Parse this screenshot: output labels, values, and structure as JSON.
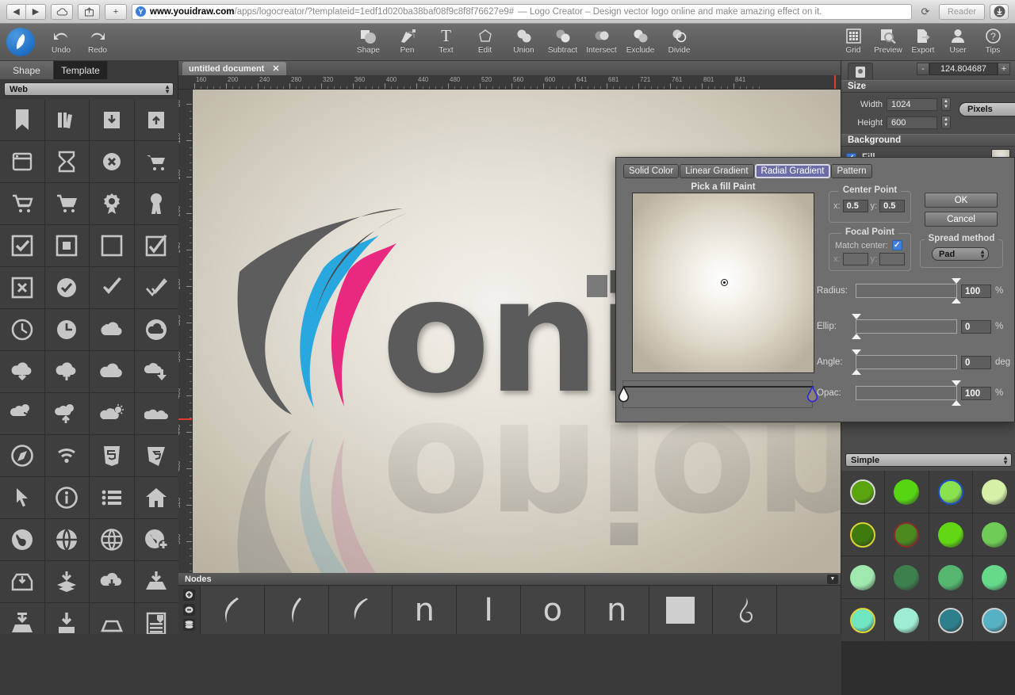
{
  "browser": {
    "back_icon": "back-arrow-icon",
    "forward_icon": "forward-arrow-icon",
    "icloud_icon": "icloud-icon",
    "share_icon": "share-icon",
    "add_tab_label": "+",
    "favicon_letter": "Y",
    "url_domain": "www.youidraw.com",
    "url_path": "/apps/logocreator/?templateid=1edf1d020ba38baf08f9c8f8f76627e9#",
    "page_title": "— Logo Creator – Design vector logo online and make amazing effect on it.",
    "reload_icon": "reload-icon",
    "reader_label": "Reader",
    "downloads_icon": "downloads-icon"
  },
  "toolbar": {
    "logo_name": "youidraw-logo",
    "undo_label": "Undo",
    "redo_label": "Redo",
    "center_tools": [
      {
        "label": "Shape",
        "icon": "shape-icon"
      },
      {
        "label": "Pen",
        "icon": "pen-icon"
      },
      {
        "label": "Text",
        "icon": "text-icon"
      },
      {
        "label": "Edit",
        "icon": "edit-node-icon"
      },
      {
        "label": "Union",
        "icon": "union-icon"
      },
      {
        "label": "Subtract",
        "icon": "subtract-icon"
      },
      {
        "label": "Intersect",
        "icon": "intersect-icon"
      },
      {
        "label": "Exclude",
        "icon": "exclude-icon"
      },
      {
        "label": "Divide",
        "icon": "divide-icon"
      }
    ],
    "right_tools": [
      {
        "label": "Grid",
        "icon": "grid-icon"
      },
      {
        "label": "Preview",
        "icon": "preview-icon"
      },
      {
        "label": "Export",
        "icon": "export-icon"
      },
      {
        "label": "User",
        "icon": "user-icon"
      },
      {
        "label": "Tips",
        "icon": "tips-icon"
      }
    ]
  },
  "left_panel": {
    "tabs": [
      {
        "label": "Shape",
        "active": false
      },
      {
        "label": "Template",
        "active": true
      }
    ],
    "category": "Web",
    "icons": [
      "bookmark-icon",
      "books-icon",
      "archive-down-icon",
      "archive-up-icon",
      "browser-window-icon",
      "hourglass-icon",
      "circle-x-icon",
      "cart-tilt-icon",
      "cart-outline-icon",
      "cart-full-icon",
      "award-ribbon-icon",
      "badge-icon",
      "checkbox-checked-icon",
      "square-filled-inner-icon",
      "square-empty-icon",
      "checkbox-check-overflow-icon",
      "box-x-icon",
      "circle-check-icon",
      "check-mark-icon",
      "double-check-icon",
      "clock-outline-icon",
      "clock-filled-icon",
      "cloud-puff-icon",
      "cloud-circle-icon",
      "cloud-download-icon",
      "cloud-upload-icon",
      "cloud-plain-icon",
      "cloud-sync-down-icon",
      "clouds-refresh-icon",
      "clouds-upload-icon",
      "cloud-sun-icon",
      "clouds-double-icon",
      "compass-icon",
      "wifi-icon",
      "html5-shield-icon",
      "css3-shield-icon",
      "cursor-arrow-icon",
      "info-circle-icon",
      "list-icon",
      "home-icon",
      "globe-icon",
      "globe-net-icon",
      "globe-wire-icon",
      "globe-plus-icon",
      "inbox-download-icon",
      "layers-download-icon",
      "cloud-down-icon",
      "tray-download-icon",
      "hdd-download-icon",
      "disk-download-icon",
      "inbox-icon",
      "server-list-icon"
    ]
  },
  "document": {
    "tab_label": "untitled document",
    "close_icon": "close-icon",
    "zoom_minus": "-",
    "zoom_value": "124.804687",
    "zoom_plus": "+",
    "h_ruler_labels": [
      "160",
      "200",
      "240",
      "280",
      "320",
      "360",
      "400",
      "440",
      "480",
      "520",
      "560",
      "600",
      "641",
      "681",
      "721",
      "761",
      "801",
      "841"
    ],
    "v_ruler_labels": [
      "80",
      "120",
      "160",
      "200",
      "240",
      "280",
      "320",
      "360",
      "400",
      "440",
      "480",
      "520",
      "560"
    ],
    "logo_text": "onion"
  },
  "nodes_panel": {
    "title": "Nodes",
    "collapse_icon": "chevron-down-icon",
    "tools": [
      "add-node-icon",
      "remove-node-icon",
      "layers-icon"
    ],
    "items": [
      "curve-1",
      "curve-2",
      "curve-3",
      "n",
      "I",
      "o",
      "n",
      "rect",
      "swirl"
    ]
  },
  "right_panel": {
    "tab_icon": "document-properties-icon",
    "size_title": "Size",
    "width_label": "Width",
    "width_value": "1024",
    "height_label": "Height",
    "height_value": "600",
    "unit_value": "Pixels",
    "background_title": "Background",
    "fill_label": "Fill",
    "fill_checked": true,
    "swatch_category": "Simple",
    "swatches": [
      "#5aa50f",
      "#55d514",
      "#8ae24f",
      "#d6f0a8",
      "#3e7a0c",
      "#4c8a20",
      "#61d813",
      "#6fcc56",
      "#a0e9ae",
      "#3e7f4e",
      "#55b670",
      "#66d98a",
      "#6fe6c0",
      "#9fecd4",
      "#2e7f8c",
      "#57b1c4"
    ],
    "swatch_rings": [
      "#dcdcdc",
      "",
      "#2050c8",
      "",
      "#e0d23a",
      "#8a2b2b",
      "",
      "",
      "",
      "",
      "",
      "",
      "#e0d23a",
      "",
      "#cfcfcf",
      "#cfcfcf"
    ]
  },
  "gradient_dialog": {
    "tabs": [
      {
        "label": "Solid Color",
        "active": false
      },
      {
        "label": "Linear Gradient",
        "active": false
      },
      {
        "label": "Radial Gradient",
        "active": true
      },
      {
        "label": "Pattern",
        "active": false
      }
    ],
    "pick_label": "Pick a fill Paint",
    "center_point_title": "Center Point",
    "center_x_label": "x:",
    "center_x_value": "0.5",
    "center_y_label": "y:",
    "center_y_value": "0.5",
    "focal_point_title": "Focal Point",
    "match_center_label": "Match center:",
    "match_center_checked": true,
    "focal_x_label": "x:",
    "focal_x_value": "",
    "focal_y_label": "y:",
    "focal_y_value": "",
    "ok_label": "OK",
    "cancel_label": "Cancel",
    "spread_title": "Spread method",
    "spread_value": "Pad",
    "sliders": [
      {
        "label": "Radius:",
        "value": "100",
        "unit": "%",
        "knob_pct": 100
      },
      {
        "label": "Ellip:",
        "value": "0",
        "unit": "%",
        "knob_pct": 0
      },
      {
        "label": "Angle:",
        "value": "0",
        "unit": "deg",
        "knob_pct": 0
      },
      {
        "label": "Opac:",
        "value": "100",
        "unit": "%",
        "knob_pct": 100
      }
    ],
    "stops": [
      {
        "color": "#ffffff",
        "position": 0,
        "selected": false
      },
      {
        "color": "#8a8170",
        "position": 100,
        "selected": true
      }
    ]
  }
}
